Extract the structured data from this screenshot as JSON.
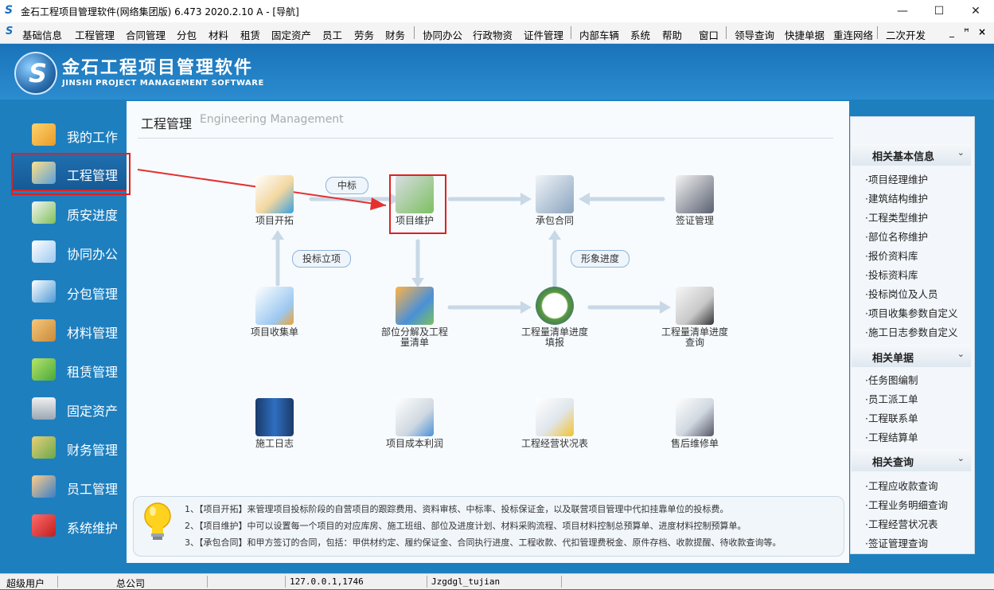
{
  "window": {
    "title": "金石工程项目管理软件(网络集团版) 6.473  2020.2.10 A - [导航]",
    "app_icon": "S",
    "min": "—",
    "max": "☐",
    "close": "✕"
  },
  "menu": [
    "基础信息",
    "工程管理",
    "合同管理",
    "分包",
    "材料",
    "租赁",
    "固定资产",
    "员工",
    "劳务",
    "财务",
    "协同办公",
    "行政物资",
    "证件管理",
    "内部车辆",
    "系统",
    "帮助",
    "窗口",
    "领导查询",
    "快捷单据",
    "重连网络",
    "二次开发"
  ],
  "mdi": {
    "min": "_",
    "restore": "ꟸ",
    "close": "×"
  },
  "brand": {
    "cn": "金石工程项目管理软件",
    "en": "JINSHI PROJECT MANAGEMENT SOFTWARE"
  },
  "nav": [
    {
      "label": "我的工作",
      "icon": "folder-user-icon"
    },
    {
      "label": "工程管理",
      "icon": "engineer-icon",
      "selected": true
    },
    {
      "label": "质安进度",
      "icon": "clock-list-icon"
    },
    {
      "label": "协同办公",
      "icon": "grid-arrow-icon"
    },
    {
      "label": "分包管理",
      "icon": "stack-icon"
    },
    {
      "label": "材料管理",
      "icon": "box-icon"
    },
    {
      "label": "租赁管理",
      "icon": "cubes-icon"
    },
    {
      "label": "固定资产",
      "icon": "server-icon"
    },
    {
      "label": "财务管理",
      "icon": "money-icon"
    },
    {
      "label": "员工管理",
      "icon": "people-icon"
    },
    {
      "label": "系统维护",
      "icon": "toolbox-icon"
    }
  ],
  "section": {
    "title": "工程管理",
    "subtitle": "Engineering Management"
  },
  "flow": {
    "nodes": [
      {
        "label": "项目开拓"
      },
      {
        "label": "项目维护"
      },
      {
        "label": "承包合同"
      },
      {
        "label": "签证管理"
      },
      {
        "label": "项目收集单"
      },
      {
        "label": "部位分解及工程量清单"
      },
      {
        "label": "工程量清单进度填报"
      },
      {
        "label": "工程量清单进度查询"
      },
      {
        "label": "施工日志"
      },
      {
        "label": "项目成本利润"
      },
      {
        "label": "工程经营状况表"
      },
      {
        "label": "售后维修单"
      }
    ],
    "tags": {
      "zhongbiao": "中标",
      "toubiao": "投标立项",
      "xingxiang": "形象进度"
    }
  },
  "tips": [
    "1、【项目开拓】来管理项目投标阶段的自营项目的跟踪费用、资料审核、中标率、投标保证金，以及联营项目管理中代扣挂靠单位的投标费。",
    "2、【项目维护】中可以设置每一个项目的对应库房、施工班组、部位及进度计划、材料采购流程、项目材料控制总预算单、进度材料控制预算单。",
    "3、【承包合同】和甲方签订的合同，包括：甲供材约定、履约保证金、合同执行进度、工程收款、代扣管理费税金、原件存档、收款提醒、待收款查询等。"
  ],
  "right_panel": {
    "groups": [
      {
        "title": "相关基本信息",
        "items": [
          "·项目经理维护",
          "·建筑结构维护",
          "·工程类型维护",
          "·部位名称维护",
          "·报价资料库",
          "·投标资料库",
          "·投标岗位及人员",
          "·项目收集参数自定义",
          "·施工日志参数自定义"
        ]
      },
      {
        "title": "相关单据",
        "items": [
          "·任务图编制",
          "·员工派工单",
          "·工程联系单",
          "·工程结算单"
        ]
      },
      {
        "title": "相关查询",
        "items": [
          "·工程应收款查询",
          "·工程业务明细查询",
          "·工程经营状况表",
          "·签证管理查询"
        ]
      }
    ],
    "caret": "⌄"
  },
  "status": [
    "超级用户",
    "总公司",
    "127.0.0.1,1746",
    "Jzgdgl_tujian"
  ]
}
